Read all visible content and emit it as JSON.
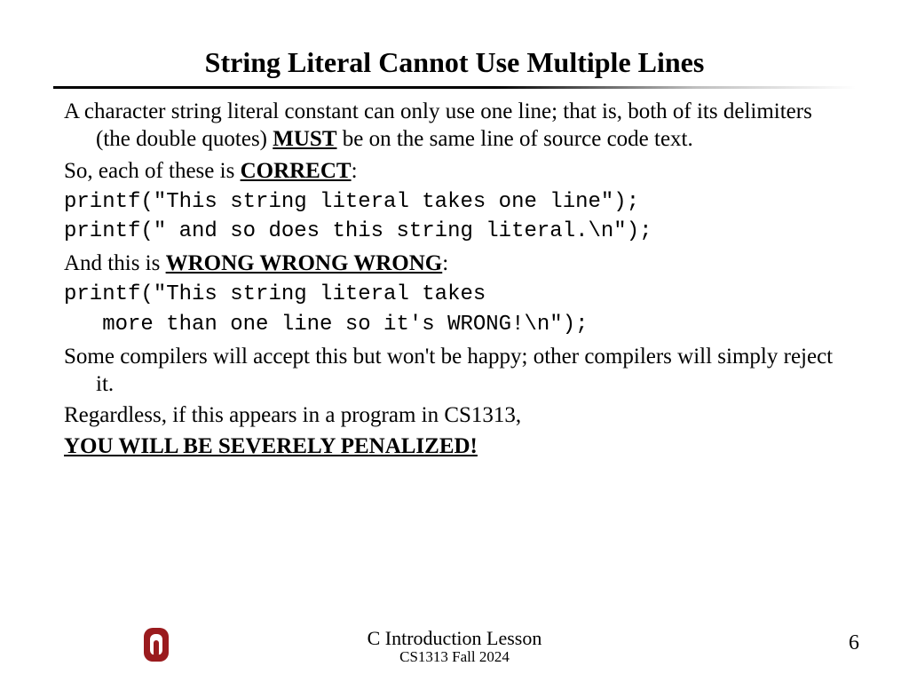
{
  "title": "String Literal Cannot Use Multiple Lines",
  "p1_a": "A character string literal constant can only use one line; that is, both of its delimiters (the double quotes) ",
  "p1_emph": "MUST",
  "p1_b": " be on the same line of source code text.",
  "p2_a": "So, each of these is ",
  "p2_emph": "CORRECT",
  "p2_b": ":",
  "code1": "printf(\"This string literal takes one line\");",
  "code2": "printf(\" and so does this string literal.\\n\");",
  "p3_a": "And this is ",
  "p3_emph": "WRONG WRONG WRONG",
  "p3_b": ":",
  "code3": "printf(\"This string literal takes",
  "code4": "   more than one line so it's WRONG!\\n\");",
  "p4": "Some compilers will accept this but won't be happy; other compilers will simply reject it.",
  "p5": "Regardless, if this appears in a program in CS1313,",
  "p6": "YOU WILL BE SEVERELY PENALIZED!",
  "footer_lesson": "C Introduction Lesson",
  "footer_course": "CS1313 Fall 2024",
  "page_number": "6",
  "logo_color": "#9a1b1e"
}
